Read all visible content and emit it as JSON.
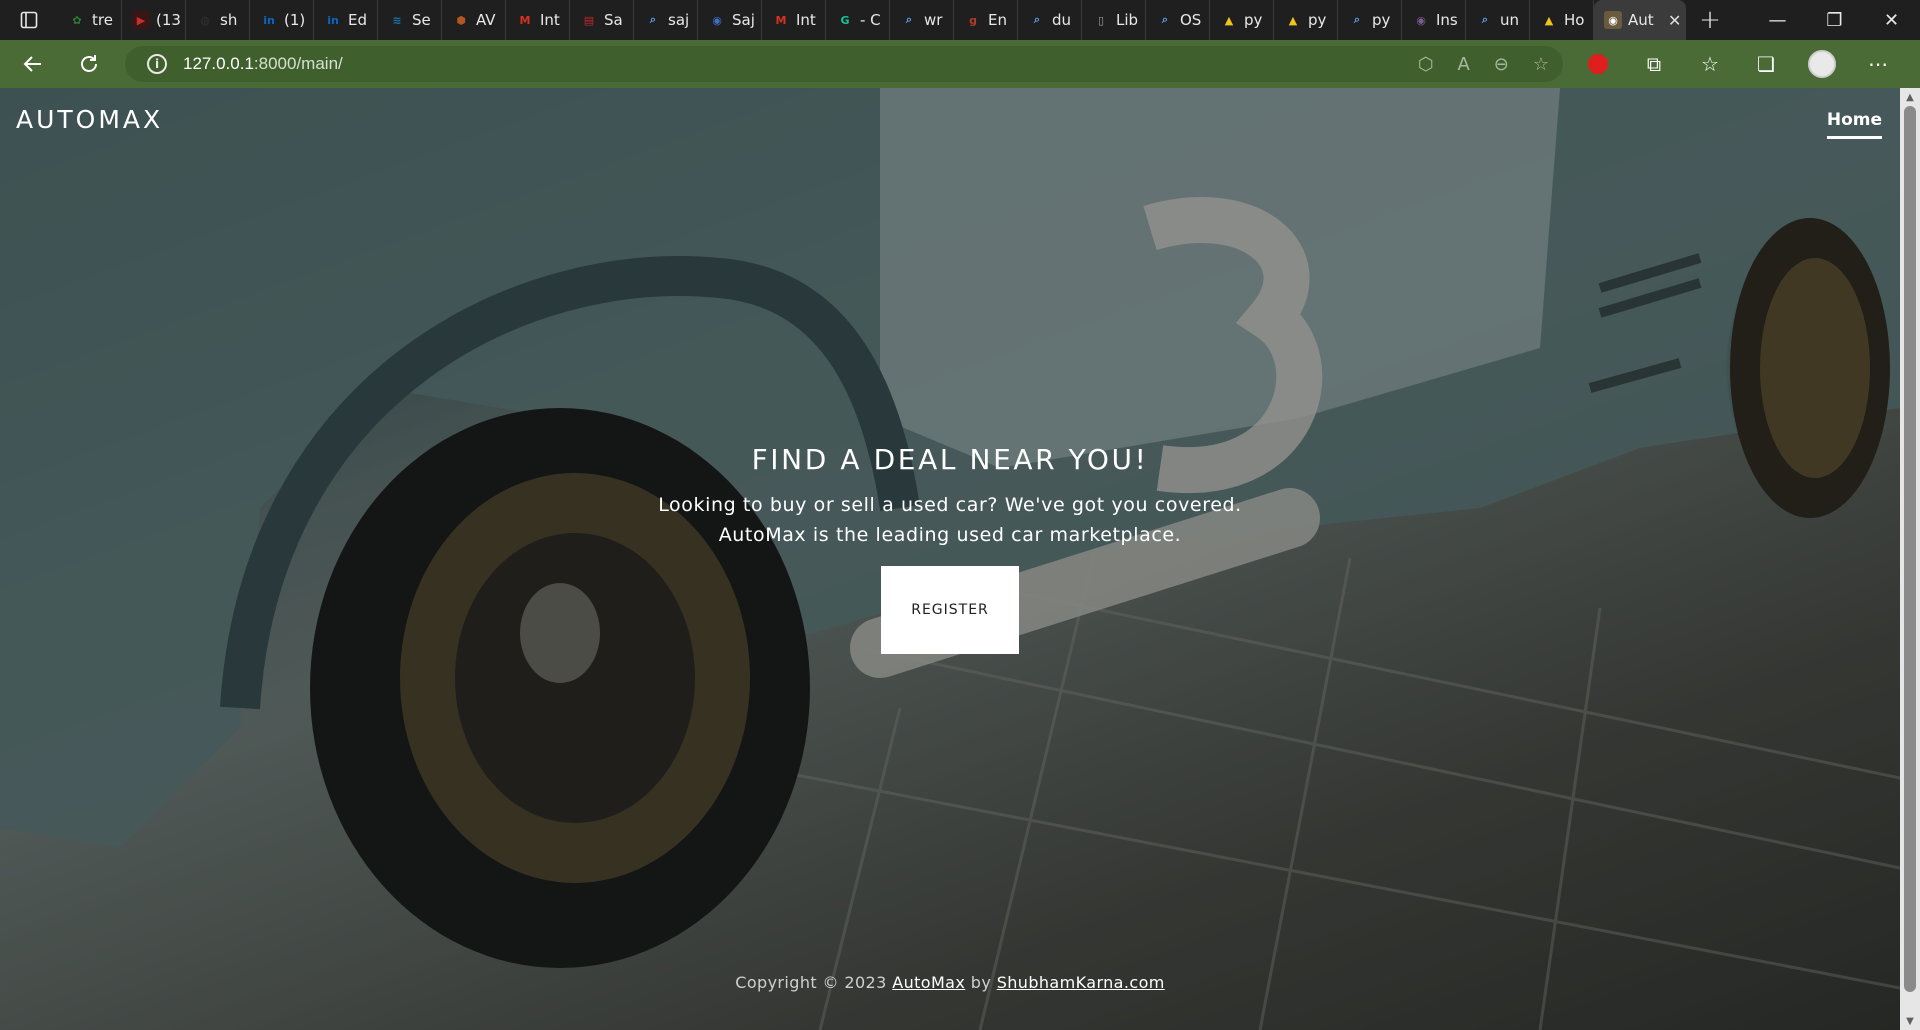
{
  "browser": {
    "tabs": [
      {
        "title": "tre",
        "icon": "plant-icon",
        "color": "#2e7d32"
      },
      {
        "title": "(13",
        "icon": "youtube-icon",
        "color": "#c4302b"
      },
      {
        "title": "sh",
        "icon": "github-icon",
        "color": "#333333"
      },
      {
        "title": "(1)",
        "icon": "linkedin-icon",
        "color": "#0a66c2"
      },
      {
        "title": "Ed",
        "icon": "linkedin-icon",
        "color": "#0a66c2"
      },
      {
        "title": "Se",
        "icon": "sap-icon",
        "color": "#1a73a8"
      },
      {
        "title": "AV",
        "icon": "hexagon-icon",
        "color": "#b0561e"
      },
      {
        "title": "Int",
        "icon": "gmail-icon",
        "color": "#d93025"
      },
      {
        "title": "Sa",
        "icon": "pdf-icon",
        "color": "#c62828"
      },
      {
        "title": "saj",
        "icon": "search-icon",
        "color": "#5aa0e6"
      },
      {
        "title": "Saj",
        "icon": "globe-icon",
        "color": "#3b6fc9"
      },
      {
        "title": "Int",
        "icon": "gmail-icon",
        "color": "#d93025"
      },
      {
        "title": "- C",
        "icon": "grammarly-icon",
        "color": "#15c39a"
      },
      {
        "title": "wr",
        "icon": "search-icon",
        "color": "#5aa0e6"
      },
      {
        "title": "En",
        "icon": "g-icon",
        "color": "#b23a2a"
      },
      {
        "title": "du",
        "icon": "search-icon",
        "color": "#5aa0e6"
      },
      {
        "title": "Lib",
        "icon": "document-icon",
        "color": "#9e9e9e"
      },
      {
        "title": "OS",
        "icon": "search-icon",
        "color": "#5aa0e6"
      },
      {
        "title": "py",
        "icon": "flame-icon",
        "color": "#f0c419"
      },
      {
        "title": "py",
        "icon": "flame-icon",
        "color": "#f0c419"
      },
      {
        "title": "py",
        "icon": "search-icon",
        "color": "#5aa0e6"
      },
      {
        "title": "Ins",
        "icon": "globe-icon",
        "color": "#7a5c8c"
      },
      {
        "title": "un",
        "icon": "search-icon",
        "color": "#5aa0e6"
      },
      {
        "title": "Ho",
        "icon": "flame-icon",
        "color": "#f0c419"
      }
    ],
    "active_tab": {
      "title": "Aut",
      "icon": "globe-icon"
    },
    "new_tab": "+",
    "url_host": "127.0.0.1",
    "url_path": ":8000/main/",
    "window": {
      "minimize": "—",
      "restore": "❐",
      "close": "✕"
    }
  },
  "site": {
    "brand": "AUTOMAX",
    "nav_home": "Home",
    "hero_title": "FIND A DEAL NEAR YOU!",
    "hero_line1": "Looking to buy or sell a used car? We've got you covered.",
    "hero_line2": "AutoMax is the leading used car marketplace.",
    "register": "REGISTER",
    "footer_prefix": "Copyright © 2023",
    "footer_link1": "AutoMax",
    "footer_by": "by",
    "footer_link2": "ShubhamKarna.com"
  }
}
